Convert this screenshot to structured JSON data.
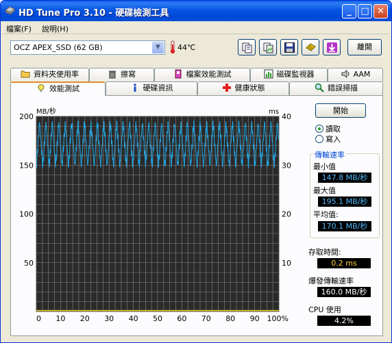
{
  "window": {
    "title": "HD Tune Pro 3.10 - 硬碟檢測工具",
    "min_label": "_",
    "max_label": "□",
    "close_label": "✕"
  },
  "menu": {
    "file": "檔案(F)",
    "help": "說明(H)"
  },
  "toolbar": {
    "drive": "OCZ APEX_SSD (62 GB)",
    "temperature": "44℃",
    "exit_label": "離開",
    "icons": [
      "copy-text-icon",
      "copy-screenshot-icon",
      "save-icon",
      "settings-icon",
      "download-icon"
    ]
  },
  "tabs_top": [
    "資料夾使用率",
    "擦寫",
    "檔案效能測試",
    "磁碟監視器",
    "AAM"
  ],
  "tabs_bottom": [
    "效能測試",
    "硬碟資訊",
    "健康狀態",
    "錯誤掃描"
  ],
  "active_tab": "效能測試",
  "controls": {
    "start_label": "開始",
    "read_label": "讀取",
    "write_label": "寫入",
    "mode": "read"
  },
  "transfer": {
    "group_label": "傳輸速率",
    "min_label": "最小值",
    "min_value": "147.8 MB/秒",
    "max_label": "最大值",
    "max_value": "195.1 MB/秒",
    "avg_label": "平均值:",
    "avg_value": "170.1 MB/秒"
  },
  "stats": {
    "access_label": "存取時間:",
    "access_value": "0.2 ms",
    "burst_label": "爆發傳輸速率",
    "burst_value": "160.0 MB/秒",
    "cpu_label": "CPU 使用",
    "cpu_value": "4.2%"
  },
  "colors": {
    "transfer_line": "#1fa8e8",
    "access_line": "#e8d81f",
    "chart_bg": "#2a2a2a",
    "grid": "#8a8a8a"
  },
  "chart_data": {
    "type": "line",
    "ylabel_left": "MB/秒",
    "ylabel_right": "ms",
    "y_ticks_left": [
      200,
      150,
      100,
      50
    ],
    "y_ticks_right": [
      40,
      30,
      20,
      10
    ],
    "x_ticks": [
      "0",
      "10",
      "20",
      "30",
      "40",
      "50",
      "60",
      "70",
      "80",
      "90",
      "100%"
    ],
    "ylim_left": [
      0,
      200
    ],
    "ylim_right": [
      0,
      40
    ],
    "xlim": [
      0,
      100
    ],
    "grid": true,
    "series": [
      {
        "name": "",
        "axis": "left",
        "pattern": "sawtooth",
        "y_min": 147.8,
        "y_max": 195.1,
        "y_avg": 170.1,
        "period_pct": 2.65
      },
      {
        "name": "",
        "axis": "right",
        "value_ms": 0.2
      }
    ]
  }
}
